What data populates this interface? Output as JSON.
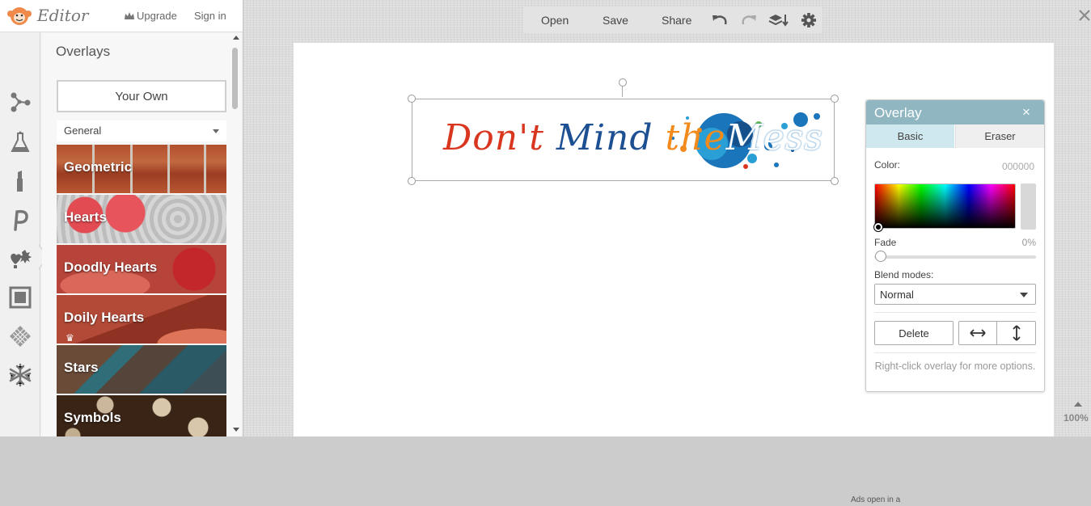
{
  "header": {
    "logo_text": "Editor",
    "upgrade_label": "Upgrade",
    "signin_label": "Sign in"
  },
  "tools": [
    "nodes-icon",
    "flask-icon",
    "lipstick-icon",
    "text-icon",
    "overlays-icon",
    "frame-icon",
    "texture-icon",
    "seasonal-icon"
  ],
  "overlays_panel": {
    "title": "Overlays",
    "your_own_label": "Your Own",
    "category": "General",
    "tiles": [
      {
        "label": "Geometric"
      },
      {
        "label": "Hearts"
      },
      {
        "label": "Doodly Hearts"
      },
      {
        "label": "Doily Hearts",
        "premium": true
      },
      {
        "label": "Stars"
      },
      {
        "label": "Symbols"
      }
    ]
  },
  "toolbar": {
    "open_label": "Open",
    "save_label": "Save",
    "share_label": "Share"
  },
  "canvas": {
    "banner": {
      "word1": "Don't",
      "word2": "Mind",
      "word3": "the",
      "word4": "Mess",
      "colors": {
        "word1": "#d9361f",
        "word2": "#1d4f93",
        "word3": "#f28a1c",
        "word4": "#ffffff",
        "splash": "#1b75bb"
      }
    }
  },
  "overlay_props": {
    "title": "Overlay",
    "close_label": "×",
    "tabs": {
      "basic": "Basic",
      "eraser": "Eraser",
      "active": "Basic"
    },
    "color_label": "Color:",
    "color_value": "000000",
    "fade_label": "Fade",
    "fade_value": "0%",
    "fade_fraction": 0,
    "blend_label": "Blend modes:",
    "blend_value": "Normal",
    "delete_label": "Delete",
    "hint": "Right-click overlay for more options."
  },
  "zoom": {
    "value": "100%"
  },
  "footer": {
    "ads_note": "Ads open in a"
  },
  "colors": {
    "accent": "#8fb6c1",
    "tab_active": "#cfe7ee"
  }
}
